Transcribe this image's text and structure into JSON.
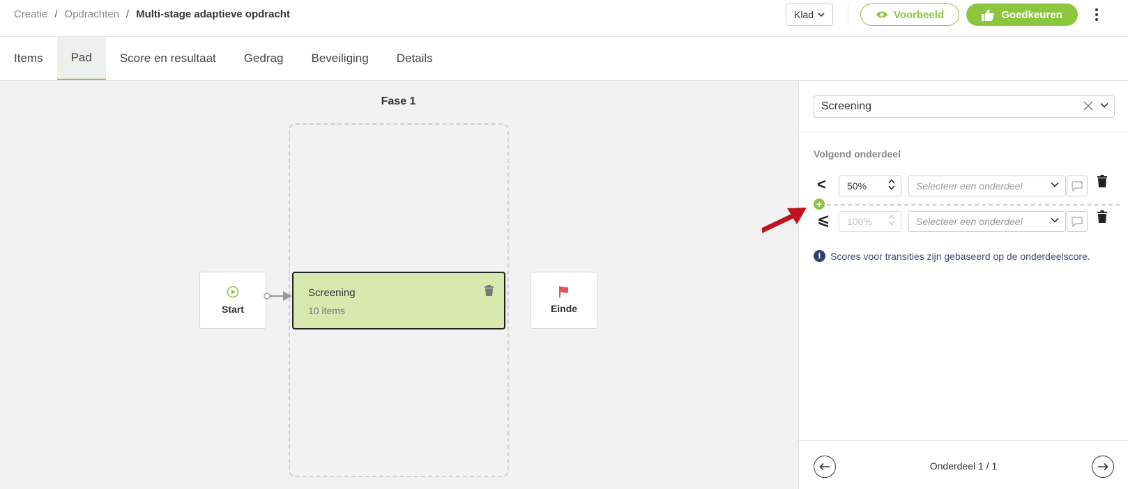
{
  "header": {
    "breadcrumb": [
      "Creatie",
      "Opdrachten",
      "Multi-stage adaptieve opdracht"
    ],
    "separator": "/",
    "status_select": "Klad",
    "preview_label": "Voorbeeld",
    "approve_label": "Goedkeuren"
  },
  "tabs": [
    {
      "label": "Items",
      "active": false
    },
    {
      "label": "Pad",
      "active": true
    },
    {
      "label": "Score en resultaat",
      "active": false
    },
    {
      "label": "Gedrag",
      "active": false
    },
    {
      "label": "Beveiliging",
      "active": false
    },
    {
      "label": "Details",
      "active": false
    }
  ],
  "canvas": {
    "phase_title": "Fase 1",
    "start_label": "Start",
    "end_label": "Einde",
    "section": {
      "title": "Screening",
      "subtitle": "10 items"
    }
  },
  "panel": {
    "selected_section": "Screening",
    "next_title": "Volgend onderdeel",
    "transitions": [
      {
        "operator": "<",
        "value": "50%",
        "disabled": false,
        "select_placeholder": "Selecteer een onderdeel"
      },
      {
        "operator": "⩽",
        "value": "100%",
        "disabled": true,
        "select_placeholder": "Selecteer een onderdeel"
      }
    ],
    "info_text": "Scores voor transities zijn gebaseerd op de onderdeelscore.",
    "pager": "Onderdeel 1 / 1"
  },
  "colors": {
    "accent": "#8cc63f",
    "section_fill": "#d8e8ae",
    "flag": "#e8505b",
    "annotation_arrow": "#c0141c"
  }
}
